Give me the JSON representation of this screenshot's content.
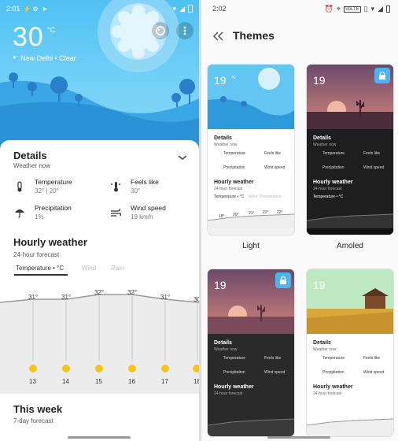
{
  "left": {
    "status": {
      "time": "2:01"
    },
    "current": {
      "temp": "30",
      "unit": "°C",
      "location": "New Delhi • Clear"
    },
    "details": {
      "title": "Details",
      "subtitle": "Weather now",
      "items": [
        {
          "label": "Temperature",
          "value": "32° | 20°",
          "icon": "thermometer-icon"
        },
        {
          "label": "Feels like",
          "value": "30°",
          "icon": "feels-like-icon"
        },
        {
          "label": "Precipitation",
          "value": "1%",
          "icon": "umbrella-icon"
        },
        {
          "label": "Wind speed",
          "value": "19 km/h",
          "icon": "wind-icon"
        }
      ]
    },
    "hourly": {
      "title": "Hourly weather",
      "subtitle": "24-hour forecast",
      "tabs": [
        "Temperature • °C",
        "Wind",
        "Rain"
      ],
      "temps": [
        "31°",
        "31°",
        "32°",
        "32°",
        "31°",
        "30"
      ],
      "hours": [
        "13",
        "14",
        "15",
        "16",
        "17",
        "18"
      ]
    },
    "week": {
      "title": "This week",
      "subtitle": "7-day forecast"
    }
  },
  "right": {
    "status": {
      "time": "2:02",
      "network": "VoLTE"
    },
    "title": "Themes",
    "themes": [
      {
        "name": "Light"
      },
      {
        "name": "Amoled"
      },
      {
        "name": "",
        "locked": true
      },
      {
        "name": "",
        "locked": false
      }
    ],
    "mini": {
      "temp": "19",
      "unit": "°C",
      "details_title": "Details",
      "details_sub": "Weather now",
      "labels": [
        "Temperature",
        "Feels like",
        "Precipitation",
        "Wind speed"
      ],
      "hourly_title": "Hourly weather",
      "hourly_sub": "24-hour forecast",
      "tabs": [
        "Temperature • °C",
        "Wind",
        "Precipitation"
      ],
      "ticks": [
        "18°",
        "20°",
        "21°",
        "22°",
        "22°"
      ]
    }
  }
}
